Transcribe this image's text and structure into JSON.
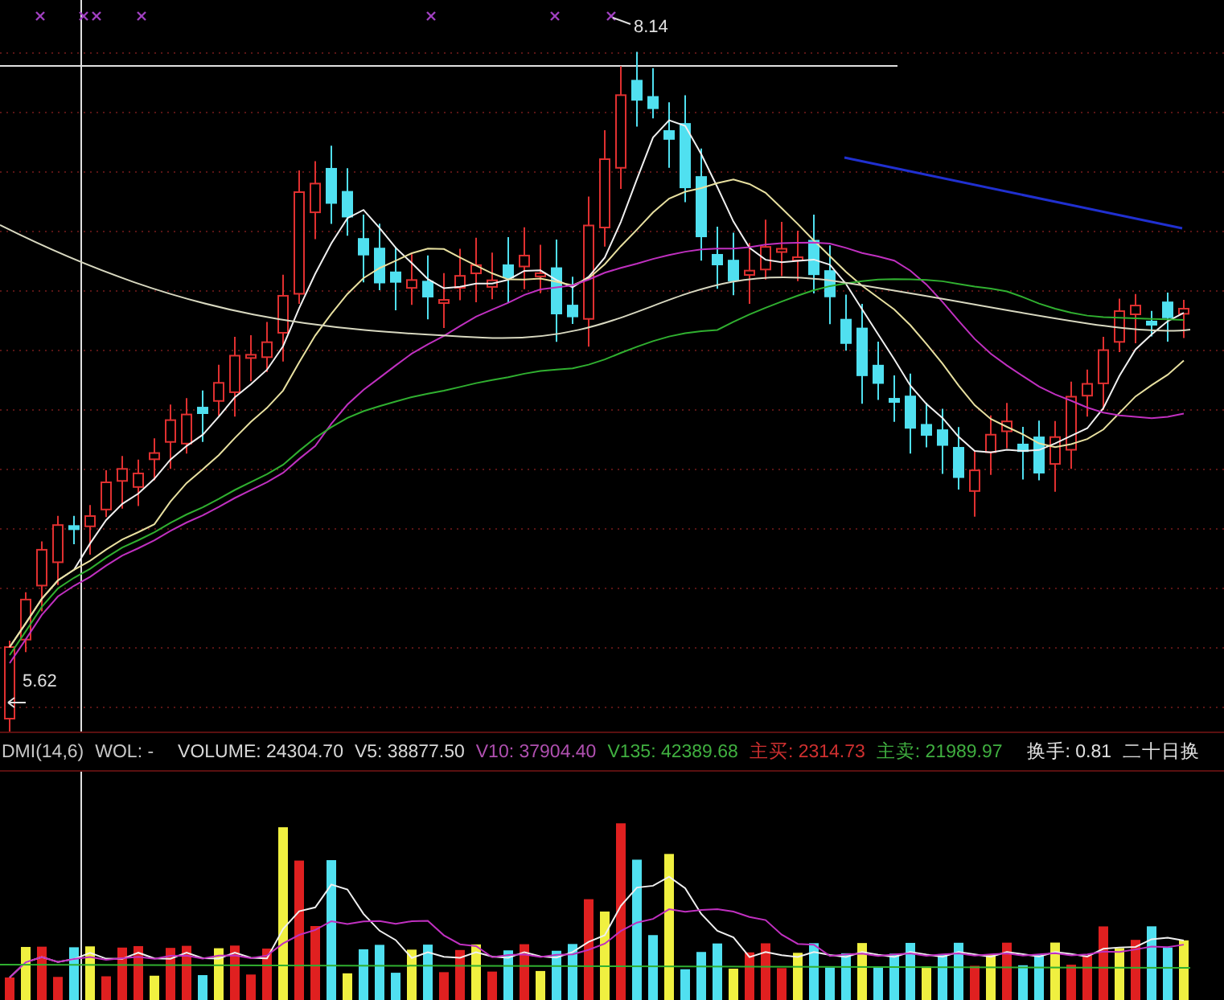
{
  "price_chart": {
    "high_label": "8.14",
    "low_label": "5.62"
  },
  "indicator_bar": [
    {
      "label": "DMI(14,6)",
      "color": "#c8c8c8"
    },
    {
      "label": "WOL:",
      "value": "-",
      "color": "#c8c8c8"
    },
    {
      "label": "VOLUME:",
      "value": "24304.70",
      "color": "#d8d8d8"
    },
    {
      "label": "V5:",
      "value": "38877.50",
      "color": "#d8d8d8"
    },
    {
      "label": "V10:",
      "value": "37904.40",
      "color": "#b050b0"
    },
    {
      "label": "V135:",
      "value": "42389.68",
      "color": "#40b040"
    },
    {
      "label": "主买:",
      "value": "2314.73",
      "color": "#d03030"
    },
    {
      "label": "主卖:",
      "value": "21989.97",
      "color": "#40b040"
    },
    {
      "label": "换手:",
      "value": "0.81",
      "color": "#e0e0e0"
    },
    {
      "label": "二十日换",
      "color": "#e0e0e0"
    }
  ]
}
